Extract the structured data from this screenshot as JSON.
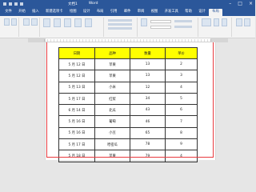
{
  "window": {
    "file_name": "文档1",
    "app_name": "Word",
    "minimize_icon": "minimize-icon",
    "maximize_icon": "maximize-icon",
    "close_icon": "close-icon"
  },
  "tabs": [
    "文件",
    "开始",
    "插入",
    "新建选项卡",
    "绘图",
    "设计",
    "布局",
    "引用",
    "邮件",
    "审阅",
    "视图",
    "开发工具",
    "帮助",
    "设计",
    "布局"
  ],
  "active_tab_index": 14,
  "table": {
    "headers": [
      "日期",
      "品种",
      "数量",
      "单价"
    ],
    "rows": [
      [
        "5 月 12 日",
        "苹果",
        "13",
        "2"
      ],
      [
        "5 月 12 日",
        "苹果",
        "13",
        "3"
      ],
      [
        "5 月 13 日",
        "小米",
        "12",
        "4"
      ],
      [
        "5 月 17 日",
        "红浆",
        "34",
        "5"
      ],
      [
        "6 月 14 日",
        "北瓜",
        "43",
        "6"
      ],
      [
        "5 月 16 日",
        "葡萄",
        "46",
        "7"
      ],
      [
        "5 月 16 日",
        "小豆",
        "65",
        "8"
      ],
      [
        "5 月 17 日",
        "哈密瓜",
        "78",
        "9"
      ],
      [
        "5 月 18 日",
        "苹果",
        "79",
        "4"
      ]
    ]
  },
  "colors": {
    "titlebar": "#2b579a",
    "header_fill": "#ffff00",
    "page_border_marker": "#e8393e"
  }
}
